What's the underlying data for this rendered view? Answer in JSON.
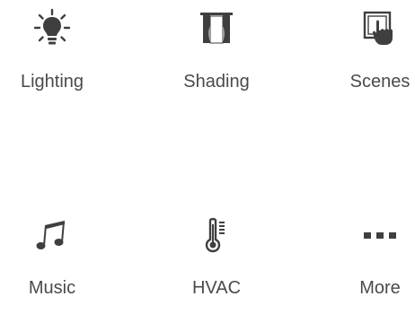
{
  "tiles": [
    {
      "label": "Lighting",
      "icon": "lightbulb-icon"
    },
    {
      "label": "Shading",
      "icon": "curtain-icon"
    },
    {
      "label": "Scenes",
      "icon": "touch-hand-icon"
    },
    {
      "label": "Music",
      "icon": "music-note-icon"
    },
    {
      "label": "HVAC",
      "icon": "thermometer-icon"
    },
    {
      "label": "More",
      "icon": "more-dots-icon"
    }
  ],
  "colors": {
    "icon": "#3f3f3f",
    "text": "#4a4a4a",
    "background": "#ffffff"
  }
}
